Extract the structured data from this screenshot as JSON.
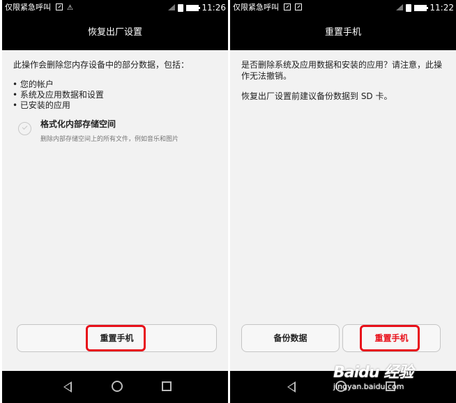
{
  "left_screen": {
    "status": {
      "carrier": "仅限紧急呼叫",
      "time": "11:26"
    },
    "title": "恢复出厂设置",
    "intro": "此操作会删除您内存设备中的部分数据，包括：",
    "items": [
      "• 您的帐户",
      "• 系统及应用数据和设置",
      "• 已安装的应用"
    ],
    "option": {
      "title": "格式化内部存储空间",
      "description": "删除内部存储空间上的所有文件，例如音乐和图片"
    },
    "reset_button": "重置手机"
  },
  "right_screen": {
    "status": {
      "carrier": "仅限紧急呼叫",
      "time": "11:22"
    },
    "title": "重置手机",
    "warning": "是否删除系统及应用数据和安装的应用？请注意，此操作无法撤销。",
    "advice": "恢复出厂设置前建议备份数据到 SD 卡。",
    "backup_button": "备份数据",
    "reset_button": "重置手机"
  },
  "watermark": {
    "brand": "Baidu 经验",
    "url": "jingyan.baidu.com"
  },
  "colors": {
    "highlight": "#e8101a",
    "bar": "#000000",
    "background": "#f2f2f2"
  }
}
